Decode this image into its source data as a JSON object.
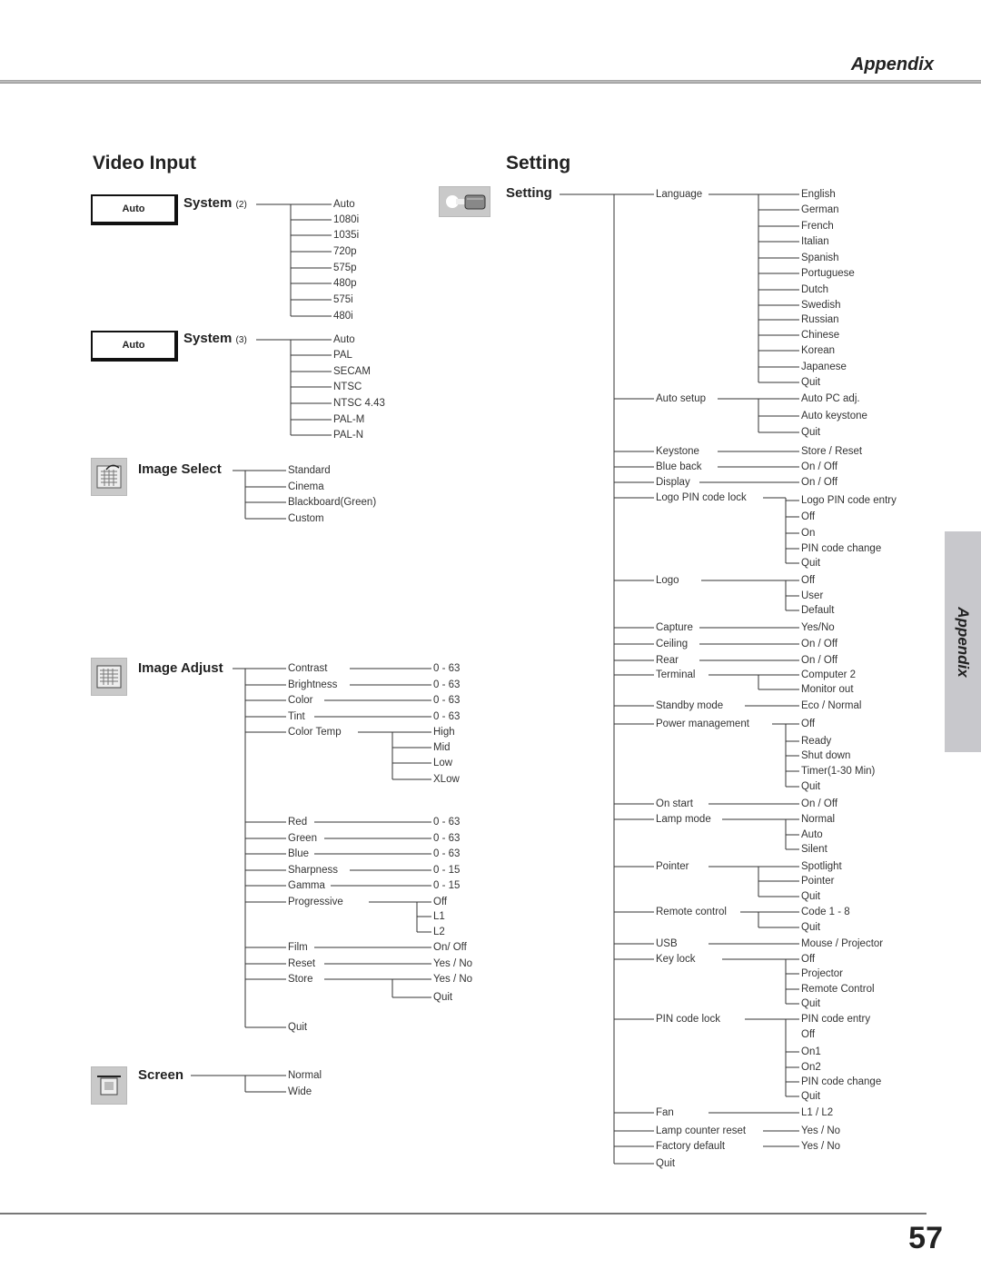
{
  "header": {
    "title": "Appendix"
  },
  "side_tab": {
    "label": "Appendix"
  },
  "page_number": "57",
  "video_input": {
    "title": "Video Input",
    "system2": {
      "box": "Auto",
      "label": "System",
      "note": "(2)",
      "options": [
        "Auto",
        "1080i",
        "1035i",
        "720p",
        "575p",
        "480p",
        "575i",
        "480i"
      ]
    },
    "system3": {
      "box": "Auto",
      "label": "System",
      "note": "(3)",
      "options": [
        "Auto",
        "PAL",
        "SECAM",
        "NTSC",
        "NTSC 4.43",
        "PAL-M",
        "PAL-N"
      ]
    },
    "image_select": {
      "label": "Image Select",
      "icon": "image-select-icon",
      "options": [
        "Standard",
        "Cinema",
        "Blackboard(Green)",
        "Custom"
      ]
    },
    "image_adjust": {
      "label": "Image Adjust",
      "icon": "image-adjust-icon",
      "items": [
        {
          "name": "Contrast",
          "value": "0 - 63"
        },
        {
          "name": "Brightness",
          "value": "0 - 63"
        },
        {
          "name": "Color",
          "value": "0 - 63"
        },
        {
          "name": "Tint",
          "value": "0 - 63"
        },
        {
          "name": "Color Temp",
          "values": [
            "High",
            "Mid",
            "Low",
            "XLow"
          ]
        },
        {
          "name": "Red",
          "value": "0 - 63"
        },
        {
          "name": "Green",
          "value": "0 - 63"
        },
        {
          "name": "Blue",
          "value": "0 - 63"
        },
        {
          "name": "Sharpness",
          "value": "0 - 15"
        },
        {
          "name": "Gamma",
          "value": "0 - 15"
        },
        {
          "name": "Progressive",
          "values": [
            "Off",
            "L1",
            "L2"
          ]
        },
        {
          "name": "Film",
          "value": "On/ Off"
        },
        {
          "name": "Reset",
          "value": "Yes / No"
        },
        {
          "name": "Store",
          "values": [
            "Yes / No",
            "Quit"
          ]
        },
        {
          "name": "Quit"
        }
      ]
    },
    "screen": {
      "label": "Screen",
      "icon": "screen-icon",
      "options": [
        "Normal",
        "Wide"
      ]
    }
  },
  "setting": {
    "title": "Setting",
    "label": "Setting",
    "icon": "setting-icon",
    "items": [
      {
        "name": "Language",
        "values": [
          "English",
          "German",
          "French",
          "Italian",
          "Spanish",
          "Portuguese",
          "Dutch",
          "Swedish",
          "Russian",
          "Chinese",
          "Korean",
          "Japanese",
          "Quit"
        ]
      },
      {
        "name": "Auto setup",
        "values": [
          "Auto PC adj.",
          "Auto keystone",
          "Quit"
        ]
      },
      {
        "name": "Keystone",
        "values": [
          "Store / Reset"
        ]
      },
      {
        "name": "Blue back",
        "values": [
          "On / Off"
        ]
      },
      {
        "name": "Display",
        "values": [
          "On / Off"
        ]
      },
      {
        "name": "Logo PIN code lock",
        "values": [
          "Logo PIN code entry",
          "Off",
          "On",
          "PIN code change",
          "Quit"
        ]
      },
      {
        "name": "Logo",
        "values": [
          "Off",
          "User",
          "Default"
        ]
      },
      {
        "name": "Capture",
        "values": [
          "Yes/No"
        ]
      },
      {
        "name": "Ceiling",
        "values": [
          "On / Off"
        ]
      },
      {
        "name": "Rear",
        "values": [
          "On / Off"
        ]
      },
      {
        "name": "Terminal",
        "values": [
          "Computer 2",
          "Monitor out"
        ]
      },
      {
        "name": "Standby mode",
        "values": [
          "Eco / Normal"
        ]
      },
      {
        "name": "Power management",
        "values": [
          "Off",
          "Ready",
          "Shut down",
          "Timer(1-30 Min)",
          "Quit"
        ]
      },
      {
        "name": "On start",
        "values": [
          "On / Off"
        ]
      },
      {
        "name": "Lamp mode",
        "values": [
          "Normal",
          "Auto",
          "Silent"
        ]
      },
      {
        "name": "Pointer",
        "values": [
          "Spotlight",
          "Pointer",
          "Quit"
        ]
      },
      {
        "name": "Remote control",
        "values": [
          "Code 1 - 8",
          "Quit"
        ]
      },
      {
        "name": "USB",
        "values": [
          "Mouse / Projector"
        ]
      },
      {
        "name": "Key lock",
        "values": [
          "Off",
          "Projector",
          "Remote Control",
          "Quit"
        ]
      },
      {
        "name": "PIN code lock",
        "values": [
          "PIN code entry",
          "Off",
          "On1",
          "On2",
          "PIN code change",
          "Quit"
        ]
      },
      {
        "name": "Fan",
        "values": [
          "L1 / L2"
        ]
      },
      {
        "name": "Lamp counter reset",
        "values": [
          "Yes / No"
        ]
      },
      {
        "name": "Factory default",
        "values": [
          "Yes / No"
        ]
      },
      {
        "name": "Quit"
      }
    ]
  }
}
